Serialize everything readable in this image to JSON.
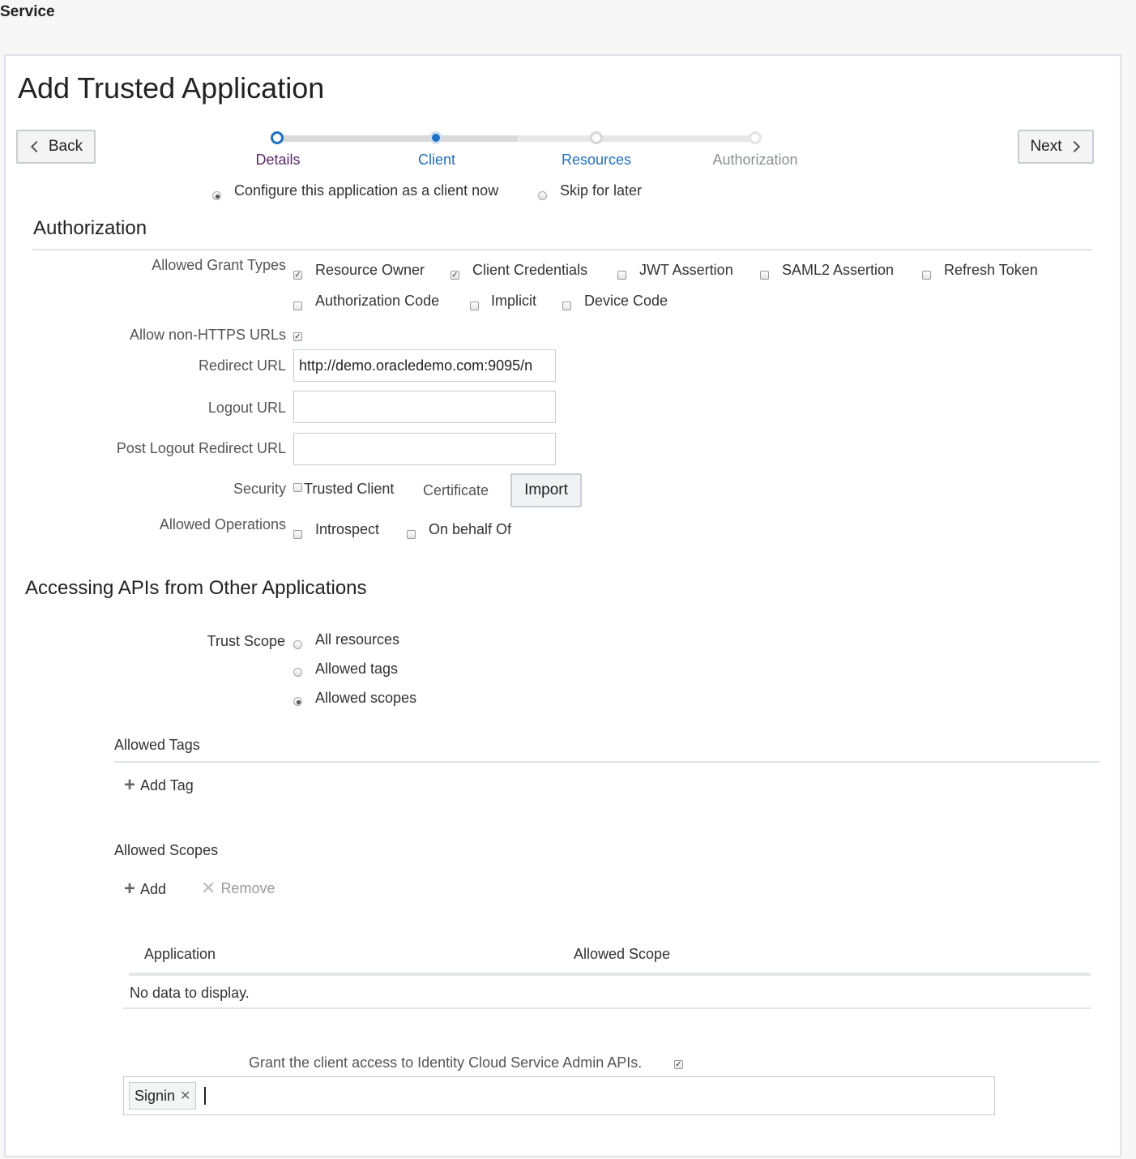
{
  "header": {
    "service_title": "Service"
  },
  "page": {
    "title": "Add Trusted Application"
  },
  "nav": {
    "back_label": "Back",
    "next_label": "Next"
  },
  "train": {
    "steps": [
      {
        "label": "Details",
        "state": "visited",
        "color": "#5b2a6e"
      },
      {
        "label": "Client",
        "state": "current",
        "color": "#1f6fc3"
      },
      {
        "label": "Resources",
        "state": "unvisited",
        "color": "#1f6fc3"
      },
      {
        "label": "Authorization",
        "state": "disabled",
        "color": "#8a8f94"
      }
    ]
  },
  "client_mode": {
    "options": [
      {
        "label": "Configure this application as a client now",
        "selected": true
      },
      {
        "label": "Skip for later",
        "selected": false
      }
    ]
  },
  "authorization": {
    "section_title": "Authorization",
    "grant_types_label": "Allowed Grant Types",
    "grant_types": [
      {
        "label": "Resource Owner",
        "checked": true
      },
      {
        "label": "Client Credentials",
        "checked": true
      },
      {
        "label": "JWT Assertion",
        "checked": false
      },
      {
        "label": "SAML2 Assertion",
        "checked": false
      },
      {
        "label": "Refresh Token",
        "checked": false
      },
      {
        "label": "Authorization Code",
        "checked": false
      },
      {
        "label": "Implicit",
        "checked": false
      },
      {
        "label": "Device Code",
        "checked": false
      }
    ],
    "non_https_label": "Allow non-HTTPS URLs",
    "non_https_checked": true,
    "redirect_url_label": "Redirect URL",
    "redirect_url_value": "http://demo.oracledemo.com:9095/n",
    "logout_url_label": "Logout URL",
    "logout_url_value": "",
    "post_logout_label": "Post Logout Redirect URL",
    "post_logout_value": "",
    "security_label": "Security",
    "trusted_client_label": "Trusted Client",
    "trusted_client_checked": false,
    "certificate_label": "Certificate",
    "import_label": "Import",
    "operations_label": "Allowed Operations",
    "operations": [
      {
        "label": "Introspect",
        "checked": false
      },
      {
        "label": "On behalf Of",
        "checked": false
      }
    ]
  },
  "apis": {
    "section_title": "Accessing APIs from Other Applications",
    "trust_scope_label": "Trust Scope",
    "trust_scope_options": [
      {
        "label": "All resources",
        "selected": false
      },
      {
        "label": "Allowed tags",
        "selected": false
      },
      {
        "label": "Allowed scopes",
        "selected": true
      }
    ],
    "allowed_tags_title": "Allowed Tags",
    "add_tag_label": "Add Tag",
    "allowed_scopes_title": "Allowed Scopes",
    "add_label": "Add",
    "remove_label": "Remove",
    "table": {
      "columns": [
        "Application",
        "Allowed Scope"
      ],
      "empty_text": "No data to display."
    },
    "admin_access_label": "Grant the client access to Identity Cloud Service Admin APIs.",
    "admin_access_checked": true,
    "roles": [
      {
        "label": "Signin"
      }
    ]
  }
}
